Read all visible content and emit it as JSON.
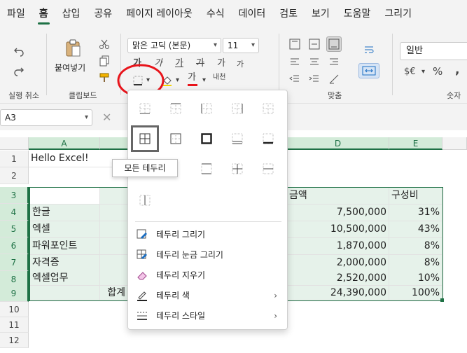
{
  "tabs": [
    "파일",
    "홈",
    "삽입",
    "공유",
    "페이지 레이아웃",
    "수식",
    "데이터",
    "검토",
    "보기",
    "도움말",
    "그리기"
  ],
  "ribbon": {
    "undo_label": "실행 취소",
    "clipboard": {
      "paste_label": "붙여넣기",
      "group_label": "클립보드"
    },
    "font": {
      "name": "맑은 고딕 (본문)",
      "size": "11",
      "bold_glyph": "가",
      "italic_glyph": "가",
      "underline_glyph": "가",
      "strike_glyph": "가",
      "grow_glyph": "가",
      "shrink_glyph": "가",
      "color_glyph": "가",
      "phonetic_glyph": "내천"
    },
    "align_group_label": "맞춤",
    "number": {
      "format": "일반",
      "currency": "$€",
      "percent": "%",
      "comma": ",",
      "group_label": "숫자"
    }
  },
  "namebox": "A3",
  "columns": [
    "A",
    "D",
    "E"
  ],
  "rows": [
    "1",
    "2",
    "3",
    "4",
    "5",
    "6",
    "7",
    "8",
    "9",
    "10",
    "11",
    "12"
  ],
  "cells": {
    "a1": "Hello Excel!",
    "d3": "금액",
    "e3": "구성비",
    "a4": "한글",
    "d4": "7,500,000",
    "e4": "31%",
    "a5": "엑셀",
    "d5": "10,500,000",
    "e5": "43%",
    "a6": "파워포인트",
    "d6": "1,870,000",
    "e6": "8%",
    "a7": "자격증",
    "d7": "2,000,000",
    "e7": "8%",
    "a8": "엑셀업무",
    "d8": "2,520,000",
    "e8": "10%",
    "b9": "합계",
    "d9": "24,390,000",
    "e9": "100%"
  },
  "border_menu": {
    "tooltip": "모든 테두리",
    "items": [
      {
        "label": "테두리 그리기",
        "icon": "pencil-icon"
      },
      {
        "label": "테두리 눈금 그리기",
        "icon": "grid-pencil-icon"
      },
      {
        "label": "테두리 지우기",
        "icon": "eraser-icon"
      },
      {
        "label": "테두리 색",
        "icon": "pen-color-icon"
      },
      {
        "label": "테두리 스타일",
        "icon": "line-style-icon"
      }
    ]
  },
  "colors": {
    "accent": "#1e7145",
    "highlight": "#e6f2ea",
    "annotation": "#e8141b"
  }
}
